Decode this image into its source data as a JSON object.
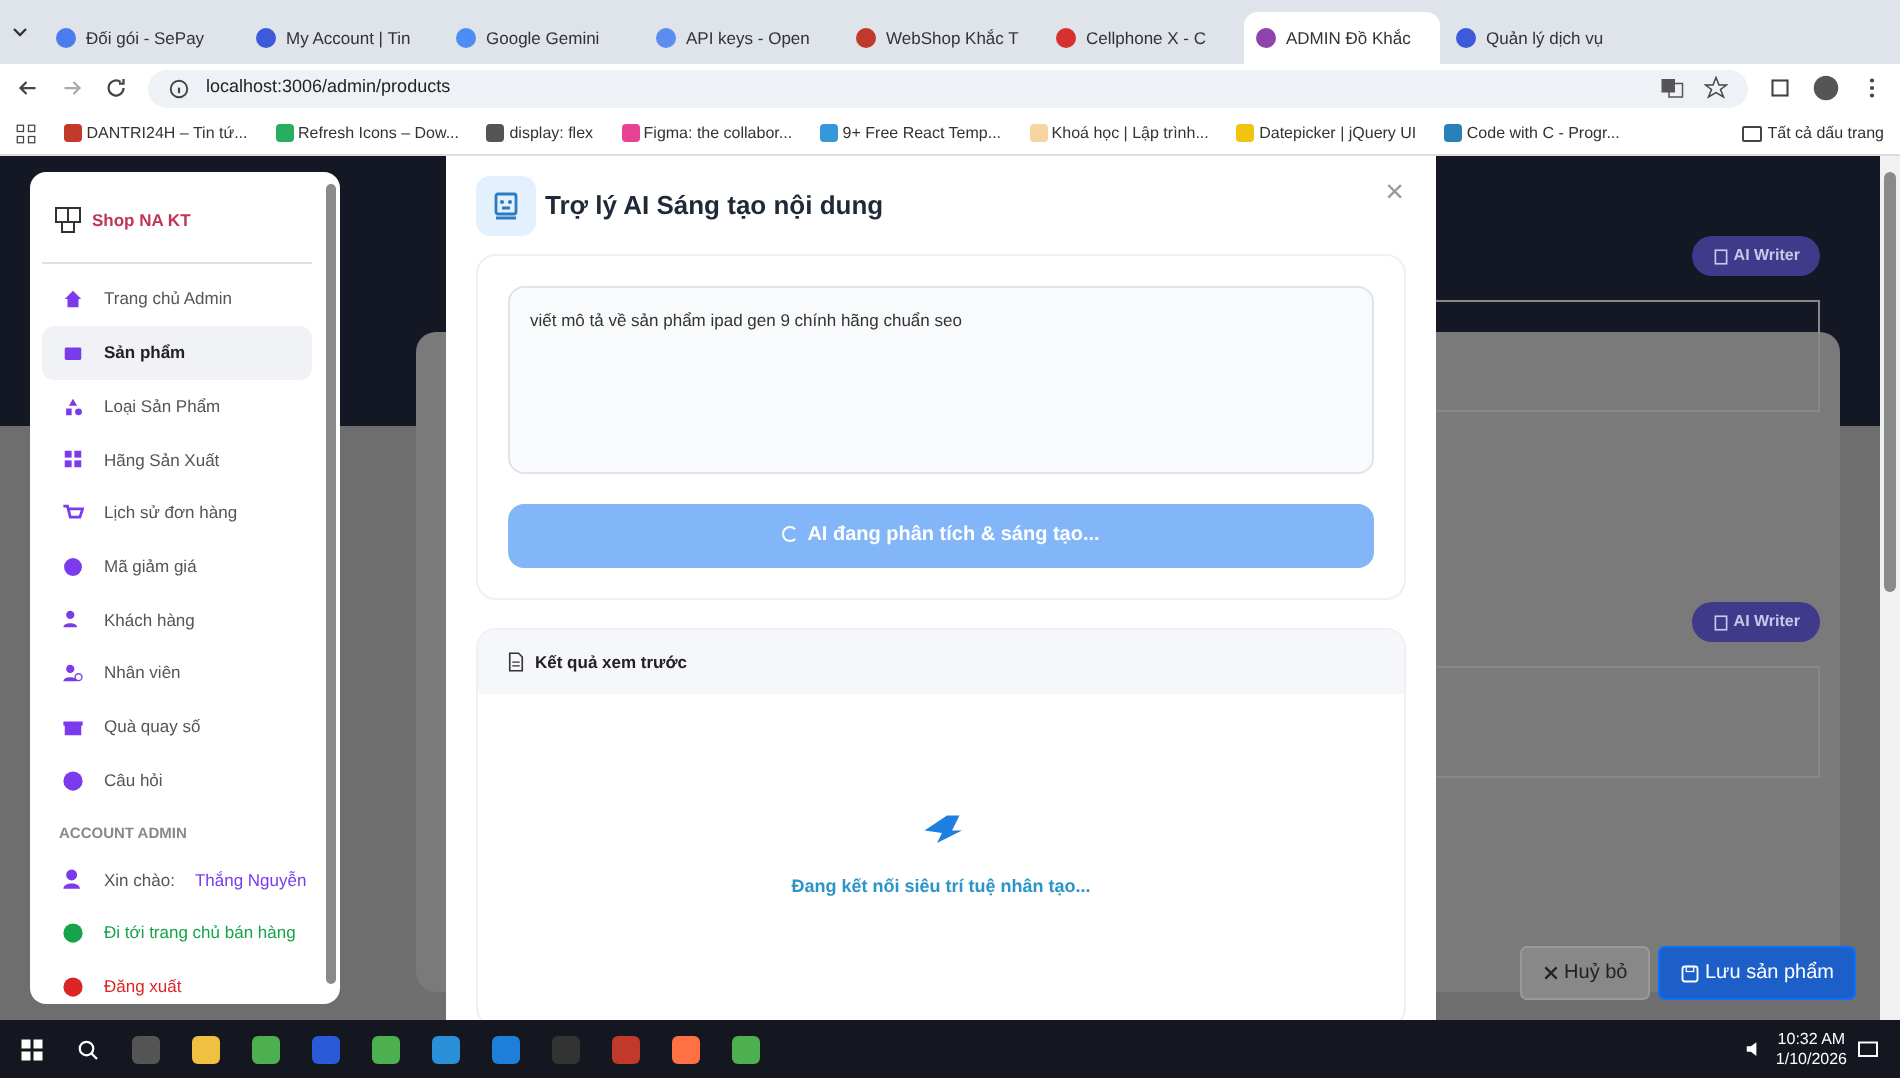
{
  "browser": {
    "tabs": [
      {
        "label": "Đối gói - SePay",
        "selected": false,
        "color": "#4b7bec"
      },
      {
        "label": "My Account | Tin",
        "selected": false,
        "color": "#3b5bdb"
      },
      {
        "label": "Google Gemini",
        "selected": false,
        "color": "#4c8df6"
      },
      {
        "label": "API keys - Open",
        "selected": false,
        "color": "#5b8def"
      },
      {
        "label": "WebShop Khắc T",
        "selected": false,
        "color": "#c0392b"
      },
      {
        "label": "Cellphone X - C",
        "selected": false,
        "color": "#d63031"
      },
      {
        "label": "ADMIN Đồ Khắc",
        "selected": true,
        "color": "#8e44ad"
      },
      {
        "label": "Quản lý dịch vụ",
        "selected": false,
        "color": "#3b5bdb"
      }
    ],
    "address": "localhost:3006/admin/products",
    "bookmarks": [
      "DANTRI24H – Tin tứ...",
      "Refresh Icons – Dow...",
      "display: flex",
      "Figma: the collabor...",
      "9+ Free React Temp...",
      "Khoá học | Lập trình...",
      "Datepicker | jQuery UI",
      "Code with C - Progr..."
    ],
    "all_bookmarks": "Tất cả dấu trang"
  },
  "sidebar": {
    "brand": "Shop NA KT",
    "items": [
      {
        "label": "Trang chủ Admin",
        "selected": false
      },
      {
        "label": "Sản phẩm",
        "selected": true
      },
      {
        "label": "Loại Sản Phẩm",
        "selected": false
      },
      {
        "label": "Hãng Sản Xuất",
        "selected": false
      },
      {
        "label": "Lịch sử đơn hàng",
        "selected": false
      },
      {
        "label": "Mã giảm giá",
        "selected": false
      },
      {
        "label": "Khách hàng",
        "selected": false
      },
      {
        "label": "Nhân viên",
        "selected": false
      },
      {
        "label": "Quà quay số",
        "selected": false
      },
      {
        "label": "Câu hỏi",
        "selected": false
      }
    ],
    "section": "ACCOUNT ADMIN",
    "account_items": [
      {
        "kind": "greeting",
        "label": "Xin chào:",
        "name": "Thắng Nguyễn",
        "color": "#7c3aed"
      },
      {
        "kind": "link",
        "label": "Đi tới trang chủ bán hàng",
        "color": "#16a34a"
      },
      {
        "kind": "link",
        "label": "Đăng xuất",
        "color": "#dc2626"
      }
    ]
  },
  "background": {
    "ai_buttons": [
      "AI Writer",
      "AI Writer"
    ],
    "cancel": "Huỷ bỏ",
    "save": "Lưu sản phẩm"
  },
  "modal": {
    "title": "Trợ lý AI Sáng tạo nội dung",
    "close": "×",
    "prompt": "viết mô tả về sản phẩm ipad gen 9 chính hãng chuẩn seo",
    "generate": {
      "label": "AI đang phân tích & sáng tạo...",
      "loading": true
    },
    "preview": {
      "title": "Kết quả xem trước",
      "status": "Đang kết nối siêu trí tuệ nhân tạo..."
    }
  },
  "taskbar": {
    "time": "10:32 AM",
    "date": "1/10/2026"
  }
}
